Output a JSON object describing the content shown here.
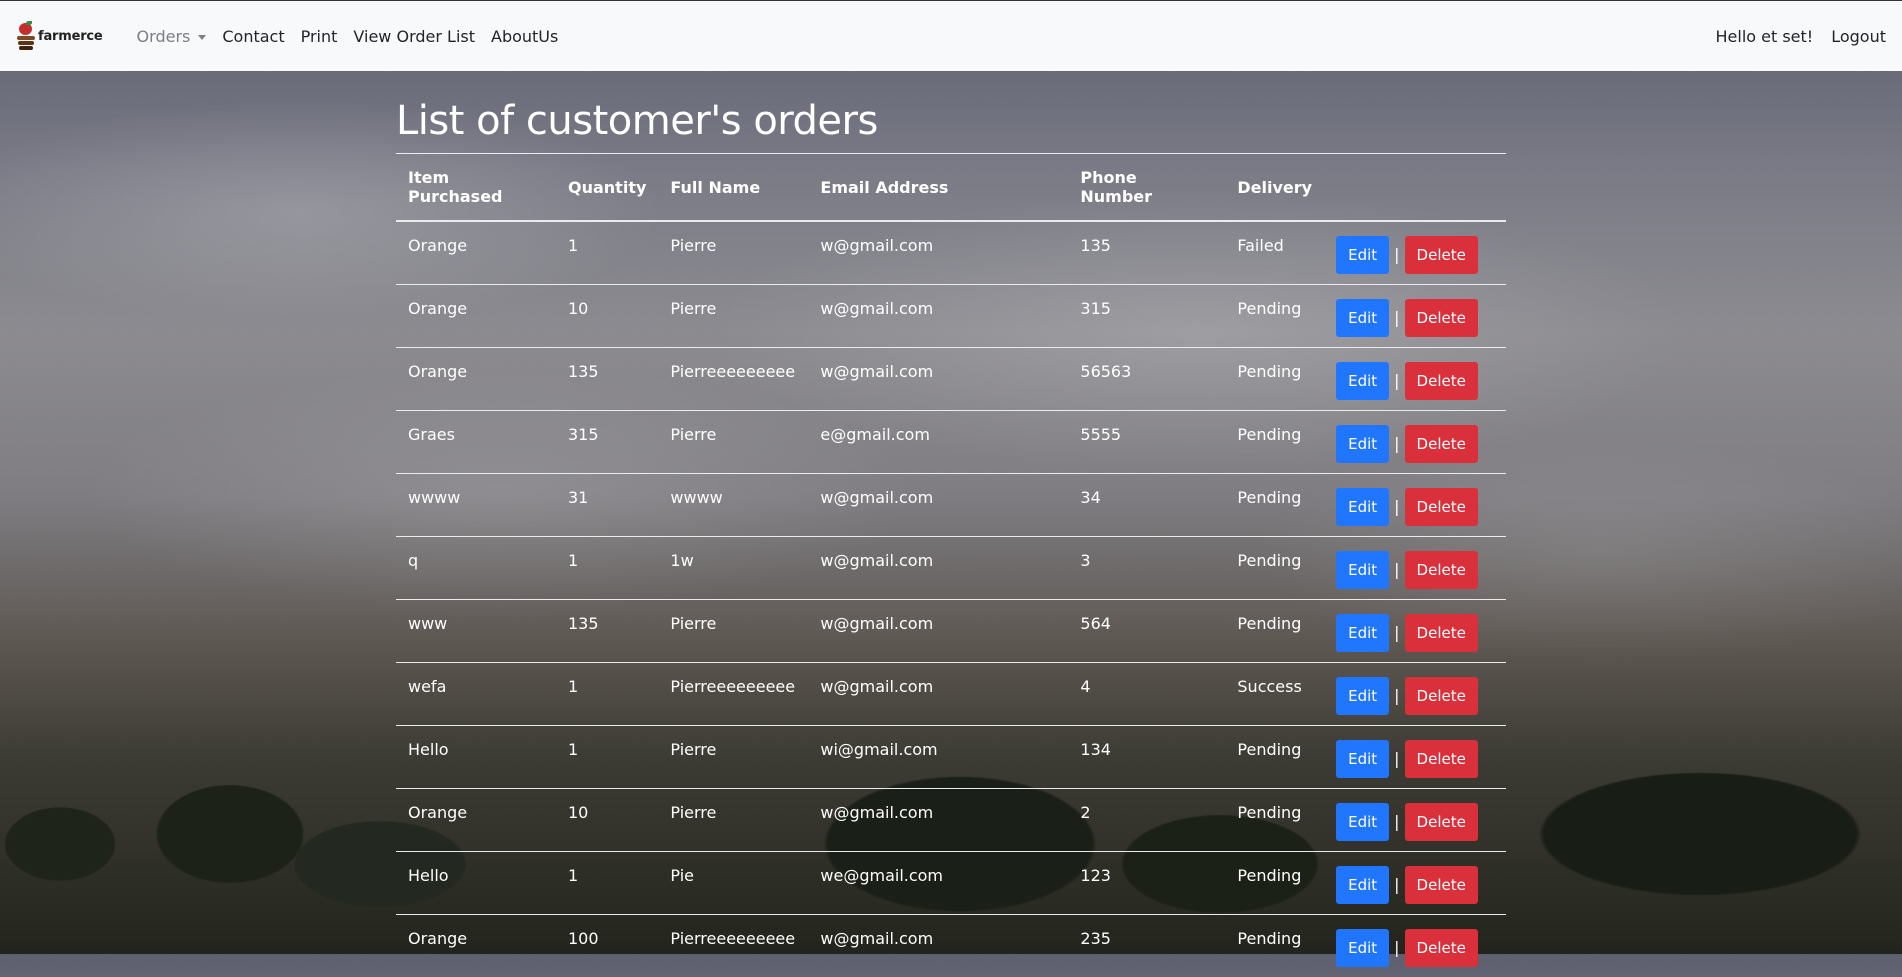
{
  "navbar": {
    "brand": "farmerce",
    "links": [
      {
        "label": "Orders"
      },
      {
        "label": "Contact"
      },
      {
        "label": "Print"
      },
      {
        "label": "View Order List"
      },
      {
        "label": "AboutUs"
      }
    ],
    "greeting": "Hello et set!",
    "logout": "Logout"
  },
  "page": {
    "title": "List of customer's orders"
  },
  "table": {
    "headers": [
      "Item Purchased",
      "Quantity",
      "Full Name",
      "Email Address",
      "Phone Number",
      "Delivery",
      ""
    ],
    "rows": [
      [
        "Orange",
        "1",
        "Pierre",
        "w@gmail.com",
        "135",
        "Failed"
      ],
      [
        "Orange",
        "10",
        "Pierre",
        "w@gmail.com",
        "315",
        "Pending"
      ],
      [
        "Orange",
        "135",
        "Pierreeeeeeeee",
        "w@gmail.com",
        "56563",
        "Pending"
      ],
      [
        "Graes",
        "315",
        "Pierre",
        "e@gmail.com",
        "5555",
        "Pending"
      ],
      [
        "wwww",
        "31",
        "wwww",
        "w@gmail.com",
        "34",
        "Pending"
      ],
      [
        "q",
        "1",
        "1w",
        "w@gmail.com",
        "3",
        "Pending"
      ],
      [
        "www",
        "135",
        "Pierre",
        "w@gmail.com",
        "564",
        "Pending"
      ],
      [
        "wefa",
        "1",
        "Pierreeeeeeeee",
        "w@gmail.com",
        "4",
        "Success"
      ],
      [
        "Hello",
        "1",
        "Pierre",
        "wi@gmail.com",
        "134",
        "Pending"
      ],
      [
        "Orange",
        "10",
        "Pierre",
        "w@gmail.com",
        "2",
        "Pending"
      ],
      [
        "Hello",
        "1",
        "Pie",
        "we@gmail.com",
        "123",
        "Pending"
      ],
      [
        "Orange",
        "100",
        "Pierreeeeeeeee",
        "w@gmail.com",
        "235",
        "Pending"
      ]
    ],
    "edit_label": "Edit",
    "separator": "|",
    "delete_label": "Delete"
  },
  "colors": {
    "edit_button": "#2176ff",
    "delete_button": "#d9303c",
    "navbar_bg": "#f8f9fa"
  }
}
